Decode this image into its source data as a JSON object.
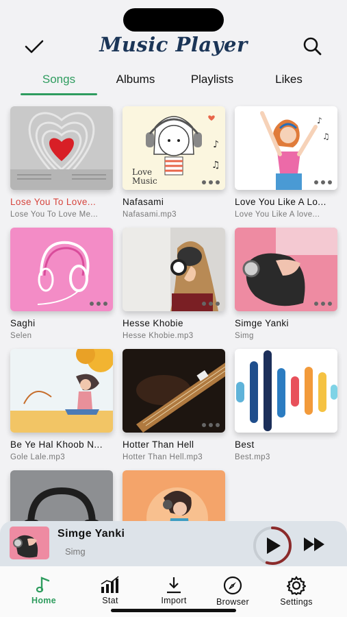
{
  "app": {
    "title": "Music Player"
  },
  "tabs": [
    {
      "label": "Songs",
      "active": true
    },
    {
      "label": "Albums",
      "active": false
    },
    {
      "label": "Playlists",
      "active": false
    },
    {
      "label": "Likes",
      "active": false
    }
  ],
  "songs": [
    {
      "title": "Lose You To Love...",
      "subtitle": "Lose You To Love Me...",
      "highlighted": true,
      "art": "heart-book"
    },
    {
      "title": "Nafasami",
      "subtitle": "Nafasami.mp3",
      "highlighted": false,
      "art": "girl-headphones-sketch",
      "art_text": [
        "Love",
        "Music"
      ]
    },
    {
      "title": "Love You Like A Lo...",
      "subtitle": "Love You Like A love...",
      "highlighted": false,
      "art": "dancing-girl"
    },
    {
      "title": "Saghi",
      "subtitle": "Selen",
      "highlighted": false,
      "art": "pink-headphones"
    },
    {
      "title": "Hesse Khobie",
      "subtitle": "Hesse Khobie.mp3",
      "highlighted": false,
      "art": "woman-headphones-wall"
    },
    {
      "title": "Simge Yanki",
      "subtitle": "Simg",
      "highlighted": false,
      "art": "upside-down-woman"
    },
    {
      "title": "Be Ye Hal Khoob N...",
      "subtitle": "Gole Lale.mp3",
      "highlighted": false,
      "art": "autumn-girl"
    },
    {
      "title": "Hotter Than Hell",
      "subtitle": "Hotter Than Hell.mp3",
      "highlighted": false,
      "art": "guitar"
    },
    {
      "title": "Best",
      "subtitle": "Best.mp3",
      "highlighted": false,
      "art": "bars"
    },
    {
      "title": "",
      "subtitle": "",
      "highlighted": false,
      "art": "grey-headphones"
    },
    {
      "title": "",
      "subtitle": "",
      "highlighted": false,
      "art": "orange-headphones"
    }
  ],
  "now_playing": {
    "title": "Simge Yanki",
    "subtitle": "Simg",
    "progress": 0.55,
    "play_icon": "play-icon",
    "next_icon": "fast-forward-icon"
  },
  "bottom_nav": [
    {
      "label": "Home",
      "icon": "music-note-icon",
      "active": true
    },
    {
      "label": "Stat",
      "icon": "bar-chart-icon",
      "active": false
    },
    {
      "label": "Import",
      "icon": "download-icon",
      "active": false
    },
    {
      "label": "Browser",
      "icon": "compass-icon",
      "active": false
    },
    {
      "label": "Settings",
      "icon": "gear-icon",
      "active": false
    }
  ],
  "colors": {
    "accent": "#2e9c5e",
    "title": "#1b3557",
    "highlight_text": "#d6443d",
    "progress_ring": "#8b2a2a"
  }
}
